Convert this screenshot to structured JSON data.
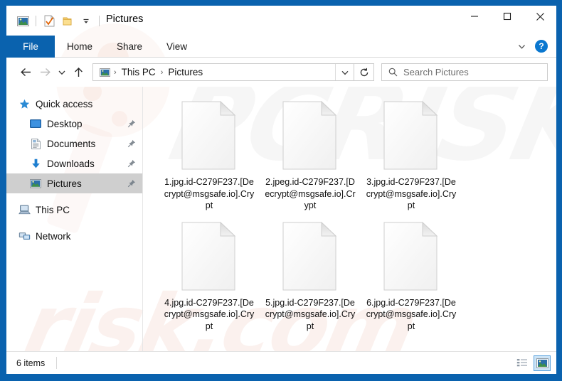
{
  "window": {
    "title": "Pictures",
    "quick_access_icons": [
      "pictures-folder-icon",
      "properties-checkmark-icon",
      "new-folder-icon",
      "customize-dropdown-icon"
    ],
    "controls": {
      "minimize": "–",
      "maximize": "☐",
      "close": "✕"
    }
  },
  "ribbon": {
    "tabs": [
      {
        "label": "File",
        "active": true
      },
      {
        "label": "Home",
        "active": false
      },
      {
        "label": "Share",
        "active": false
      },
      {
        "label": "View",
        "active": false
      }
    ],
    "collapse_icon": "chevron-down-icon",
    "help_label": "?"
  },
  "navigation": {
    "back_icon": "back-arrow-icon",
    "forward_icon": "forward-arrow-icon",
    "recent_icon": "recent-locations-chevron-icon",
    "up_icon": "up-arrow-icon",
    "breadcrumb": [
      "This PC",
      "Pictures"
    ],
    "breadcrumb_separator": "›",
    "address_dropdown_icon": "chevron-down-icon",
    "refresh_icon": "refresh-icon"
  },
  "search": {
    "placeholder": "Search Pictures",
    "icon": "search-icon"
  },
  "sidebar": {
    "items": [
      {
        "label": "Quick access",
        "icon": "star-icon",
        "level": 0,
        "pinned": false,
        "selected": false
      },
      {
        "label": "Desktop",
        "icon": "desktop-icon",
        "level": 1,
        "pinned": true,
        "selected": false
      },
      {
        "label": "Documents",
        "icon": "documents-icon",
        "level": 1,
        "pinned": true,
        "selected": false
      },
      {
        "label": "Downloads",
        "icon": "downloads-icon",
        "level": 1,
        "pinned": true,
        "selected": false
      },
      {
        "label": "Pictures",
        "icon": "pictures-icon",
        "level": 1,
        "pinned": true,
        "selected": true
      },
      {
        "label": "This PC",
        "icon": "this-pc-icon",
        "level": 0,
        "pinned": false,
        "selected": false
      },
      {
        "label": "Network",
        "icon": "network-icon",
        "level": 0,
        "pinned": false,
        "selected": false
      }
    ]
  },
  "files": [
    {
      "name": "1.jpg.id-C279F237.[Decrypt@msgsafe.io].Crypt",
      "icon": "blank-document-icon"
    },
    {
      "name": "2.jpeg.id-C279F237.[Decrypt@msgsafe.io].Crypt",
      "icon": "blank-document-icon"
    },
    {
      "name": "3.jpg.id-C279F237.[Decrypt@msgsafe.io].Crypt",
      "icon": "blank-document-icon"
    },
    {
      "name": "4.jpg.id-C279F237.[Decrypt@msgsafe.io].Crypt",
      "icon": "blank-document-icon"
    },
    {
      "name": "5.jpg.id-C279F237.[Decrypt@msgsafe.io].Crypt",
      "icon": "blank-document-icon"
    },
    {
      "name": "6.jpg.id-C279F237.[Decrypt@msgsafe.io].Crypt",
      "icon": "blank-document-icon"
    }
  ],
  "status": {
    "item_count": "6 items",
    "view_details_icon": "details-view-icon",
    "view_large_icons_icon": "large-icons-view-icon",
    "active_view": "large-icons"
  },
  "watermark": {
    "top_text": "PCRISK",
    "bottom_text": "risk.com"
  },
  "colors": {
    "frame_blue": "#0a62ae",
    "tab_active_blue": "#0a62ae",
    "help_blue": "#0a77cf",
    "selection_gray": "#cfcfcf",
    "view_active_blue": "#cce4f7"
  }
}
